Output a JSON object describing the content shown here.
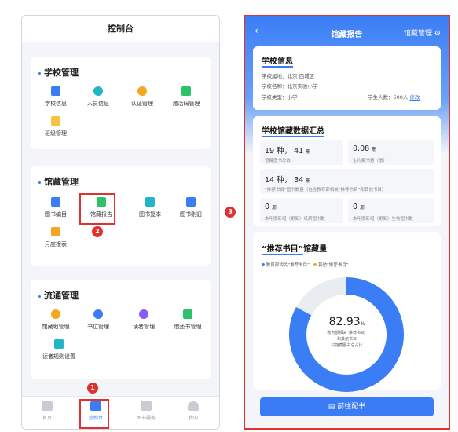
{
  "left": {
    "header_title": "控制台",
    "school": {
      "title": "学校管理",
      "items": [
        {
          "label": "学校信息",
          "color": "#3b7df5"
        },
        {
          "label": "人员信息",
          "color": "#22b5c8"
        },
        {
          "label": "认证管理",
          "color": "#f5a623"
        },
        {
          "label": "激活码管理",
          "color": "#2cc26b"
        },
        {
          "label": "班级管理",
          "color": "#f5c242"
        }
      ]
    },
    "collection": {
      "title": "馆藏管理",
      "items": [
        {
          "label": "图书编目",
          "color": "#3b7df5"
        },
        {
          "label": "馆藏报告",
          "color": "#2cc26b"
        },
        {
          "label": "图书复本",
          "color": "#22b5c8"
        },
        {
          "label": "图书剔旧",
          "color": "#3b7df5"
        },
        {
          "label": "月度报表",
          "color": "#f5a623"
        }
      ]
    },
    "circulation": {
      "title": "流通管理",
      "items": [
        {
          "label": "馆藏地管理",
          "color": "#f5a623"
        },
        {
          "label": "书位管理",
          "color": "#3b7df5"
        },
        {
          "label": "读者管理",
          "color": "#8a5cf5"
        },
        {
          "label": "借还书管理",
          "color": "#2cc26b"
        },
        {
          "label": "读者规则设置",
          "color": "#22b5c8"
        }
      ]
    },
    "tabs": [
      {
        "label": "首页"
      },
      {
        "label": "控制台"
      },
      {
        "label": "图书服务"
      },
      {
        "label": "我的"
      }
    ]
  },
  "badges": {
    "b1": "1",
    "b2": "2",
    "b3": "3"
  },
  "right": {
    "nav_title": "馆藏报告",
    "nav_action": "馆藏管理",
    "school_info": {
      "title": "学校信息",
      "location": "学校属地：北京 西城区",
      "name": "学校名称：北京实验小学",
      "type": "学校类型：小学",
      "students": "学生人数：500人",
      "edit": "修改"
    },
    "summary": {
      "title": "学校馆藏数据汇总",
      "stat1_value": "19 种， 41",
      "stat1_unit": "册",
      "stat1_label": "馆藏图书总数",
      "stat2_value": "0.08",
      "stat2_unit": "册",
      "stat2_label": "生均藏书量（册）",
      "stat3_value": "14 种， 34",
      "stat3_unit": "册",
      "stat3_label": "“推荐书目”图书数量（包含教育部相关“推荐书目”和其他书目）",
      "stat4_value": "0",
      "stat4_unit": "册",
      "stat4_label": "本年度新增（更新）纸质图书数",
      "stat5_value": "0",
      "stat5_unit": "册",
      "stat5_label": "本年度新增（更新）生均图书数"
    },
    "holdings": {
      "title_a": "“推荐书目”",
      "title_b": "馆藏量",
      "legend1": "教育部相关“推荐书目”",
      "legend2": "其他“推荐书目”",
      "legend1_color": "#3b7df5",
      "legend2_color": "#f5a623",
      "percent": "82.93",
      "percent_unit": "%",
      "caption1": "教育部相关“推荐书目”",
      "caption2": "和其他书目",
      "caption3": "占馆藏图书总占比",
      "fraction": 0.8293
    },
    "cta": "前往配书"
  }
}
